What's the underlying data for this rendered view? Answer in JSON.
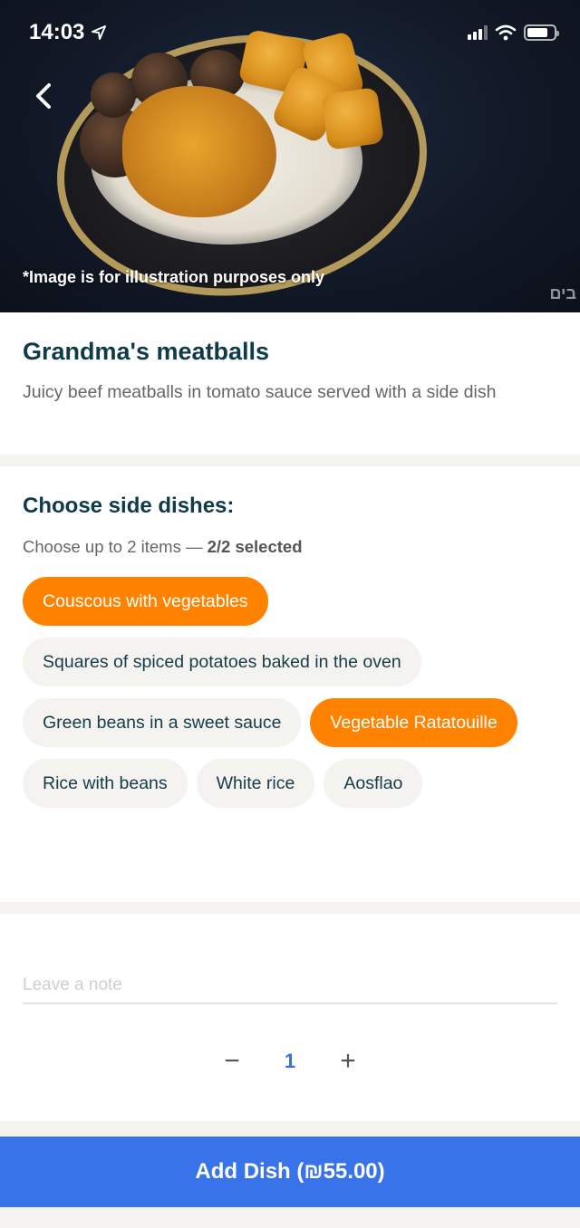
{
  "status_bar": {
    "time": "14:03",
    "location_icon": "location-arrow-icon",
    "signal_icon": "cellular-signal-icon",
    "wifi_icon": "wifi-icon",
    "battery_icon": "battery-icon",
    "battery_level": 0.8
  },
  "hero": {
    "back_icon": "chevron-left-icon",
    "disclaimer": "*Image is for illustration purposes only",
    "watermark": "בים"
  },
  "dish": {
    "title": "Grandma's meatballs",
    "description": "Juicy beef meatballs in tomato sauce served with a side dish"
  },
  "side_dishes": {
    "title": "Choose side dishes:",
    "subtitle_prefix": "Choose up to 2 items — ",
    "subtitle_count": "2/2 selected",
    "options": [
      {
        "label": "Couscous with vegetables",
        "selected": true
      },
      {
        "label": "Squares of spiced potatoes baked in the oven",
        "selected": false
      },
      {
        "label": "Green beans in a sweet sauce",
        "selected": false
      },
      {
        "label": "Vegetable Ratatouille",
        "selected": true
      },
      {
        "label": "Rice with beans",
        "selected": false
      },
      {
        "label": "White rice",
        "selected": false
      },
      {
        "label": "Aosflao",
        "selected": false
      }
    ]
  },
  "note": {
    "placeholder": "Leave a note",
    "value": ""
  },
  "quantity": {
    "minus": "−",
    "value": "1",
    "plus": "+"
  },
  "add_button": {
    "label": "Add Dish (₪55.00)"
  },
  "colors": {
    "accent_orange": "#ff8200",
    "primary_blue": "#3873ea",
    "title_navy": "#0e3a4a",
    "chip_bg": "#f5f3f0"
  }
}
